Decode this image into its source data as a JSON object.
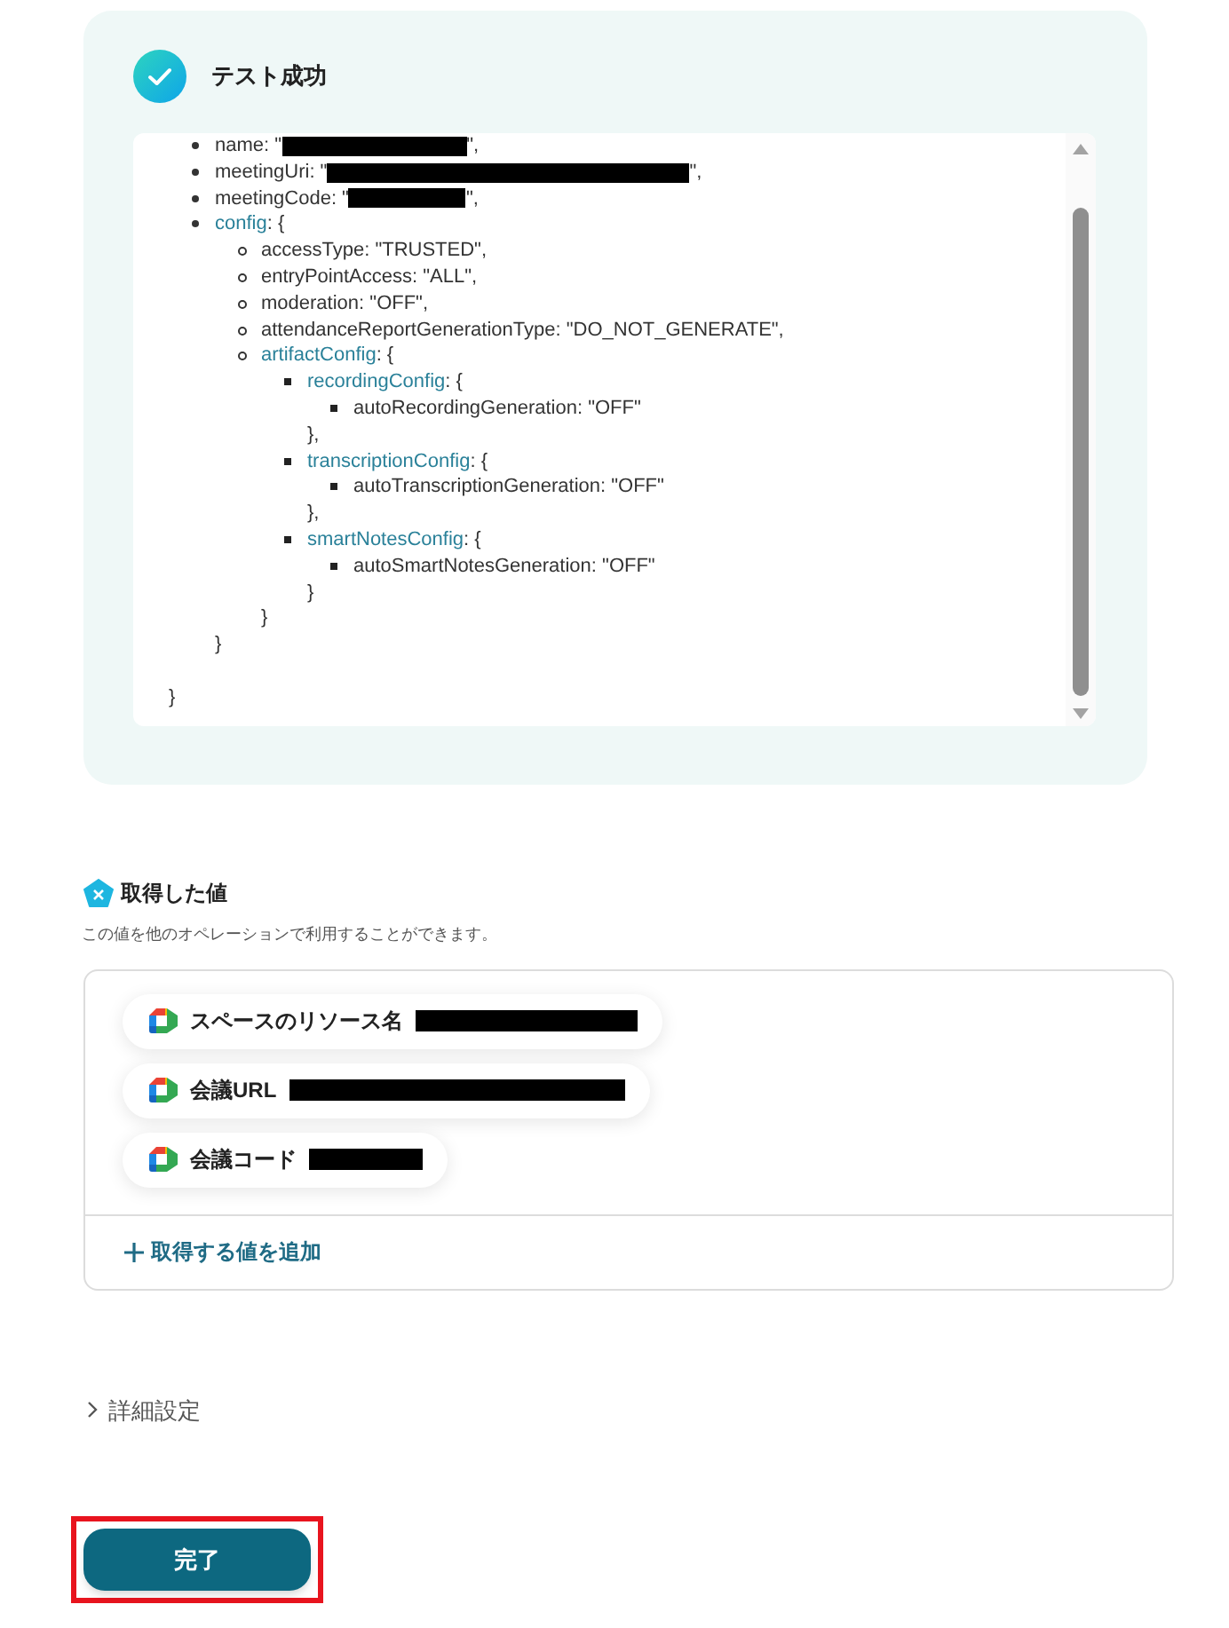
{
  "result": {
    "title": "テスト成功",
    "lines": [
      {
        "key": "name",
        "value": ": \"",
        "redacted": true,
        "tail": "\","
      },
      {
        "key": "meetingUri",
        "value": ": \"",
        "redacted": true,
        "tail": "\","
      },
      {
        "key": "meetingCode",
        "value": ": \"",
        "redacted": true,
        "tail": "\","
      },
      {
        "kind": "object",
        "key": "config",
        "value": ": {",
        "close": "}",
        "children": [
          {
            "key": "accessType",
            "value": ": \"TRUSTED\","
          },
          {
            "key": "entryPointAccess",
            "value": ": \"ALL\","
          },
          {
            "key": "moderation",
            "value": ": \"OFF\","
          },
          {
            "key": "attendanceReportGenerationType",
            "value": ": \"DO_NOT_GENERATE\","
          },
          {
            "kind": "object",
            "key": "artifactConfig",
            "value": ": {",
            "close": "}",
            "children": [
              {
                "kind": "object",
                "key": "recordingConfig",
                "value": ": {",
                "close": "},",
                "children": [
                  {
                    "key": "autoRecordingGeneration",
                    "value": ": \"OFF\""
                  }
                ]
              },
              {
                "kind": "object",
                "key": "transcriptionConfig",
                "value": ": {",
                "close": "},",
                "children": [
                  {
                    "key": "autoTranscriptionGeneration",
                    "value": ": \"OFF\""
                  }
                ]
              },
              {
                "kind": "object",
                "key": "smartNotesConfig",
                "value": ": {",
                "close": "}",
                "children": [
                  {
                    "key": "autoSmartNotesGeneration",
                    "value": ": \"OFF\""
                  }
                ]
              }
            ]
          }
        ]
      }
    ],
    "final_close": "}"
  },
  "values": {
    "title": "取得した値",
    "subtitle": "この値を他のオペレーションで利用することができます。",
    "items": [
      {
        "label": "スペースのリソース名",
        "redacted": true
      },
      {
        "label": "会議URL",
        "redacted": true
      },
      {
        "label": "会議コード",
        "redacted": true
      }
    ],
    "add_label": "取得する値を追加"
  },
  "advanced": {
    "label": "詳細設定",
    "expanded": false
  },
  "done_button": {
    "label": "完了",
    "highlighted": true
  }
}
